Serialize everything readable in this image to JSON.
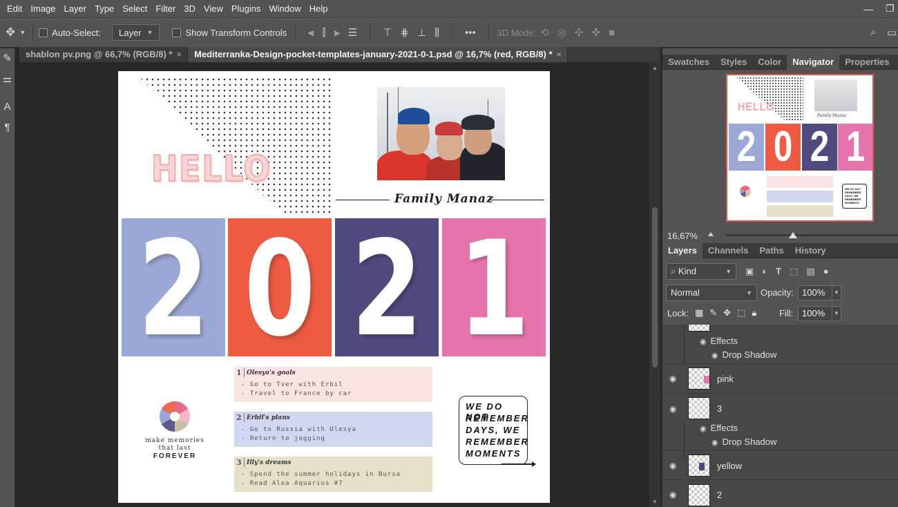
{
  "menu": [
    "Edit",
    "Image",
    "Layer",
    "Type",
    "Select",
    "Filter",
    "3D",
    "View",
    "Plugins",
    "Window",
    "Help"
  ],
  "window_controls": {
    "minimize": "—",
    "restore": "❐"
  },
  "options": {
    "move_icon": "move-icon",
    "auto_select_label": "Auto-Select:",
    "auto_select_target": "Layer",
    "show_transform_label": "Show Transform Controls",
    "more": "•••",
    "mode_3d_label": "3D Mode:"
  },
  "doc_tabs": [
    {
      "label": "shablon pv.png @ 66,7% (RGB/8) *",
      "active": false
    },
    {
      "label": "Mediterranka-Design-pocket-templates-january-2021-0-1.psd @ 16,7% (red, RGB/8) *",
      "active": true
    }
  ],
  "tab_close": "×",
  "document": {
    "hello": "HELLO",
    "family": "Family Manaz",
    "year_tiles": [
      {
        "digit": "2",
        "color": "#9ca8d6"
      },
      {
        "digit": "0",
        "color": "#ee5b42"
      },
      {
        "digit": "2",
        "color": "#4f4b7e"
      },
      {
        "digit": "1",
        "color": "#e775ad"
      }
    ],
    "tagline": [
      "make memories",
      "that last",
      "FOREVER"
    ],
    "notes": [
      {
        "num": "1",
        "title": "Olesya's goals",
        "lines": [
          "- Go to Tver with Erbil",
          "- Travel to France by car"
        ],
        "color": "#f9e3e3"
      },
      {
        "num": "2",
        "title": "Erbil's plans",
        "lines": [
          "- Go to Russia with Olesya",
          "- Return to jogging"
        ],
        "color": "#d1d7f0"
      },
      {
        "num": "3",
        "title": "Illy's dreams",
        "lines": [
          "- Spend the summer holidays in Bursa",
          "- Read Alea Aquarius #7"
        ],
        "color": "#e6e0c8"
      }
    ],
    "quote": [
      "WE DO NOT",
      "REMEMBER",
      "DAYS,   WE",
      "REMEMBER",
      "MOMENTS"
    ]
  },
  "panel_tabs_top": [
    {
      "label": "Swatches",
      "active": false
    },
    {
      "label": "Styles",
      "active": false
    },
    {
      "label": "Color",
      "active": false
    },
    {
      "label": "Navigator",
      "active": true
    },
    {
      "label": "Properties",
      "active": false
    }
  ],
  "navigator": {
    "zoom": "16,67%"
  },
  "panel_tabs_layers": [
    {
      "label": "Layers",
      "active": true
    },
    {
      "label": "Channels",
      "active": false
    },
    {
      "label": "Paths",
      "active": false
    },
    {
      "label": "History",
      "active": false
    }
  ],
  "layers_panel": {
    "kind": "Kind",
    "blend_mode": "Normal",
    "opacity_label": "Opacity:",
    "opacity": "100%",
    "lock_label": "Lock:",
    "fill_label": "Fill:",
    "fill": "100%"
  },
  "layers": [
    {
      "type": "fx",
      "label": "Effects",
      "indent": 1
    },
    {
      "type": "fx",
      "label": "Drop Shadow",
      "indent": 2
    },
    {
      "type": "layer",
      "name": "pink",
      "swatch": "#e775ad"
    },
    {
      "type": "layer",
      "name": "3",
      "swatch": ""
    },
    {
      "type": "fx",
      "label": "Effects",
      "indent": 1
    },
    {
      "type": "fx",
      "label": "Drop Shadow",
      "indent": 2
    },
    {
      "type": "layer",
      "name": "yellow",
      "swatch": "#4f4b7e"
    },
    {
      "type": "layer",
      "name": "2",
      "swatch": ""
    }
  ]
}
